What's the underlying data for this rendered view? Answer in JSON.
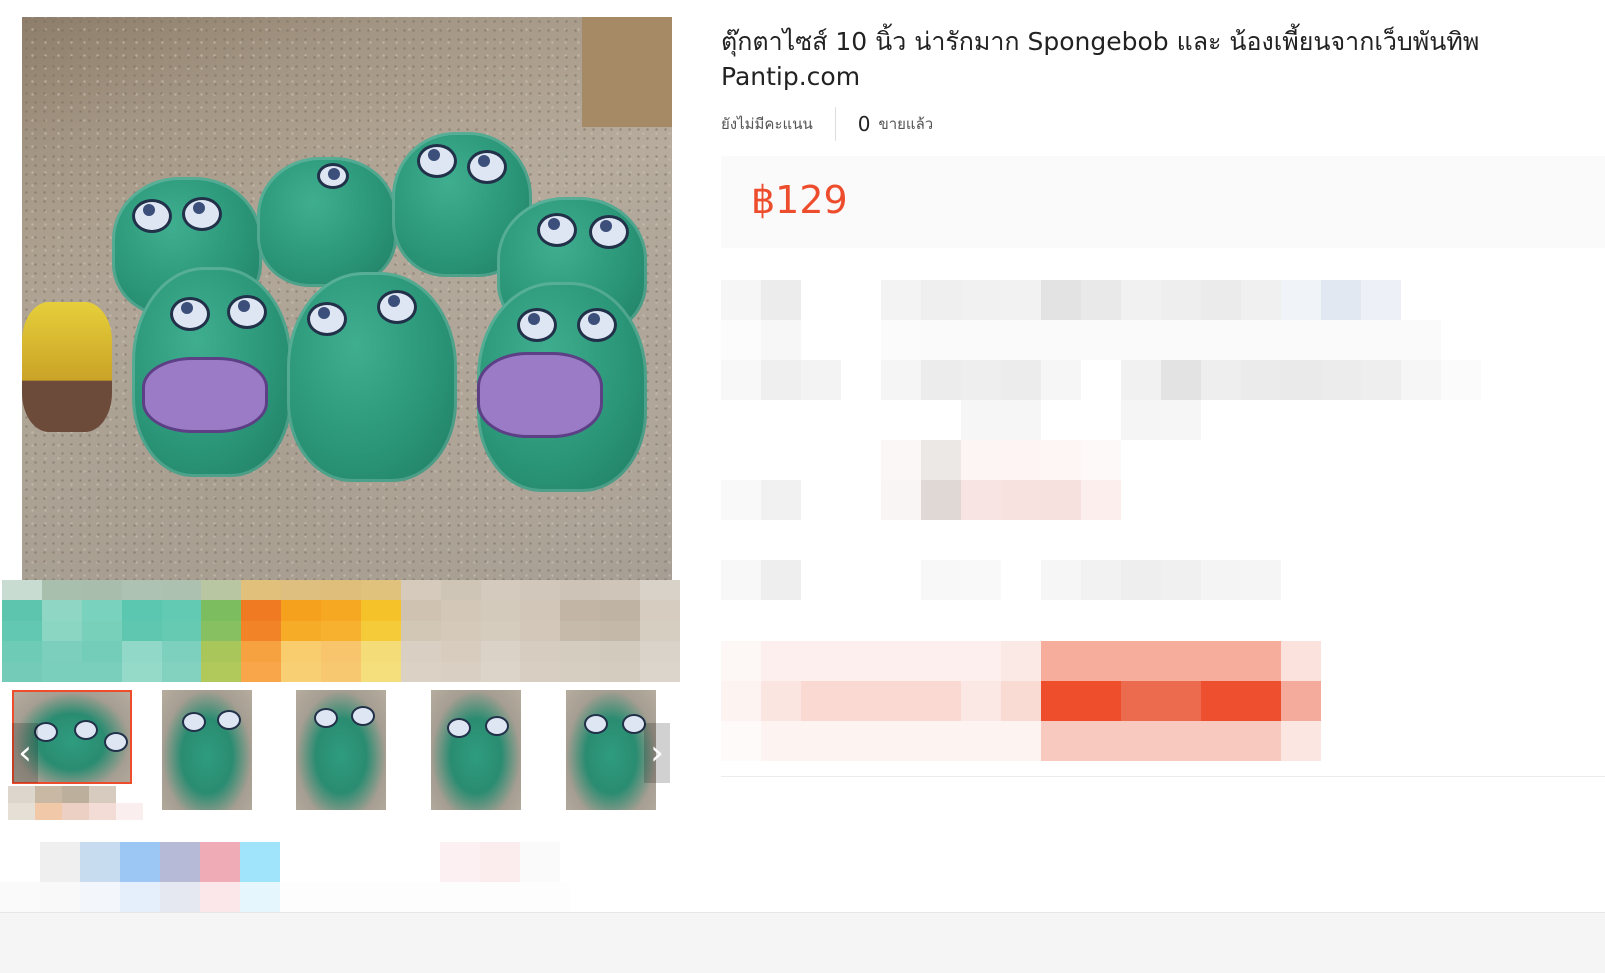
{
  "product": {
    "title_line1": "ตุ๊กตาไซส์ 10 นิ้ว น่ารักมาก Spongebob และ น้องเพี้ยนจากเว็บพันทิพ",
    "title_line2": "Pantip.com",
    "rating_text": "ยังไม่มีคะแนน",
    "sold_count": "0",
    "sold_label": "ขายแล้ว",
    "price": "฿129"
  },
  "gallery": {
    "thumbnails": [
      "thumb-1",
      "thumb-2",
      "thumb-3",
      "thumb-4",
      "thumb-5"
    ],
    "prev_arrow": "‹",
    "next_arrow": "›"
  },
  "colors": {
    "accent": "#ee4d2d",
    "price_bg": "#fafafa",
    "plush_green": "#2b9678"
  },
  "icons": [
    "chevron-left-icon",
    "chevron-right-icon"
  ]
}
